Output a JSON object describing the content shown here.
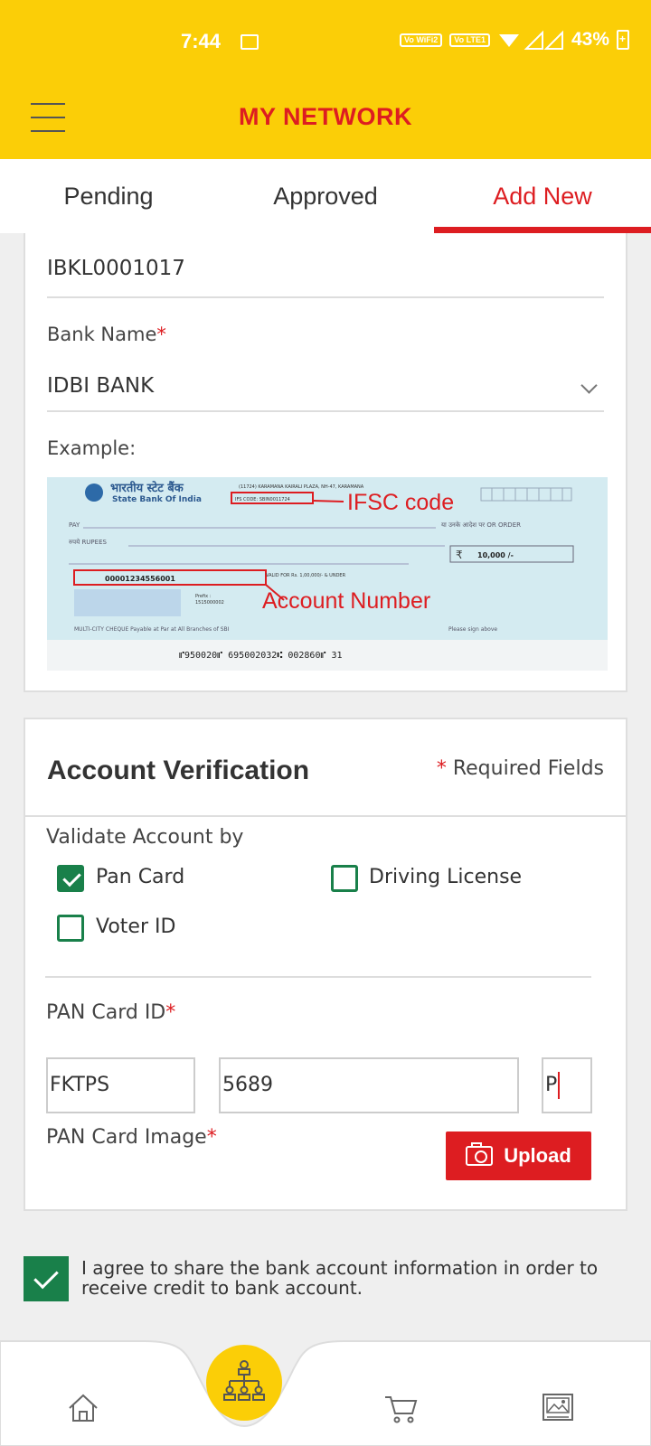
{
  "status_bar": {
    "time": "7:44",
    "network1": "Vo WiFi2",
    "network2": "Vo LTE1",
    "battery": "43%"
  },
  "app": {
    "title": "MY NETWORK"
  },
  "tabs": [
    {
      "label": "Pending",
      "active": false
    },
    {
      "label": "Approved",
      "active": false
    },
    {
      "label": "Add New",
      "active": true
    }
  ],
  "bank_details": {
    "ifsc_value": "IBKL0001017",
    "bank_name_label": "Bank Name",
    "bank_name_value": "IDBI BANK",
    "example_label": "Example:",
    "cheque_image": {
      "bank_hindi": "भारतीय स्टेट बैंक",
      "bank_english": "State Bank Of India",
      "ifs_code_text": "IFS CODE: SBIN0011724",
      "branch_text": "(11724) KARAMANA KAIRALI PLAZA, NH-47, KARAMANA",
      "ifsc_annotation": "IFSC code",
      "account_annotation": "Account Number",
      "pay_label": "PAY",
      "or_order": "या उनके आदेश पर OR ORDER",
      "rupees_label": "रुपये RUPEES",
      "amount": "10,000 /-",
      "account_number": "00001234556001",
      "valid_text": "VALID FOR Rs. 1,00,000/- & UNDER",
      "prefix_label": "Prefix :",
      "prefix_value": "1515000002",
      "multicity": "MULTI-CITY CHEQUE Payable at Par at All Branches of SBI",
      "sign_above": "Please sign above",
      "micr_line": "⑈950020⑈ 695002032⑆ 002860⑈ 31"
    }
  },
  "account_verification": {
    "title": "Account Verification",
    "required_fields": "Required Fields",
    "validate_label": "Validate Account by",
    "options": [
      {
        "label": "Pan Card",
        "checked": true
      },
      {
        "label": "Driving License",
        "checked": false
      },
      {
        "label": "Voter ID",
        "checked": false
      }
    ],
    "pan_id_label": "PAN Card ID",
    "pan_part1": "FKTPS",
    "pan_part2": "5689",
    "pan_part3": "P",
    "pan_image_label": "PAN Card Image",
    "upload_label": "Upload"
  },
  "agreement": {
    "checked": true,
    "text": "I agree to share the bank account information in order to receive credit to bank account."
  },
  "bottom_nav": [
    "home-icon",
    "network-icon",
    "cart-icon",
    "gallery-icon"
  ],
  "colors": {
    "brand_yellow": "#fbce07",
    "brand_red": "#dd1d21",
    "check_green": "#19804a"
  }
}
